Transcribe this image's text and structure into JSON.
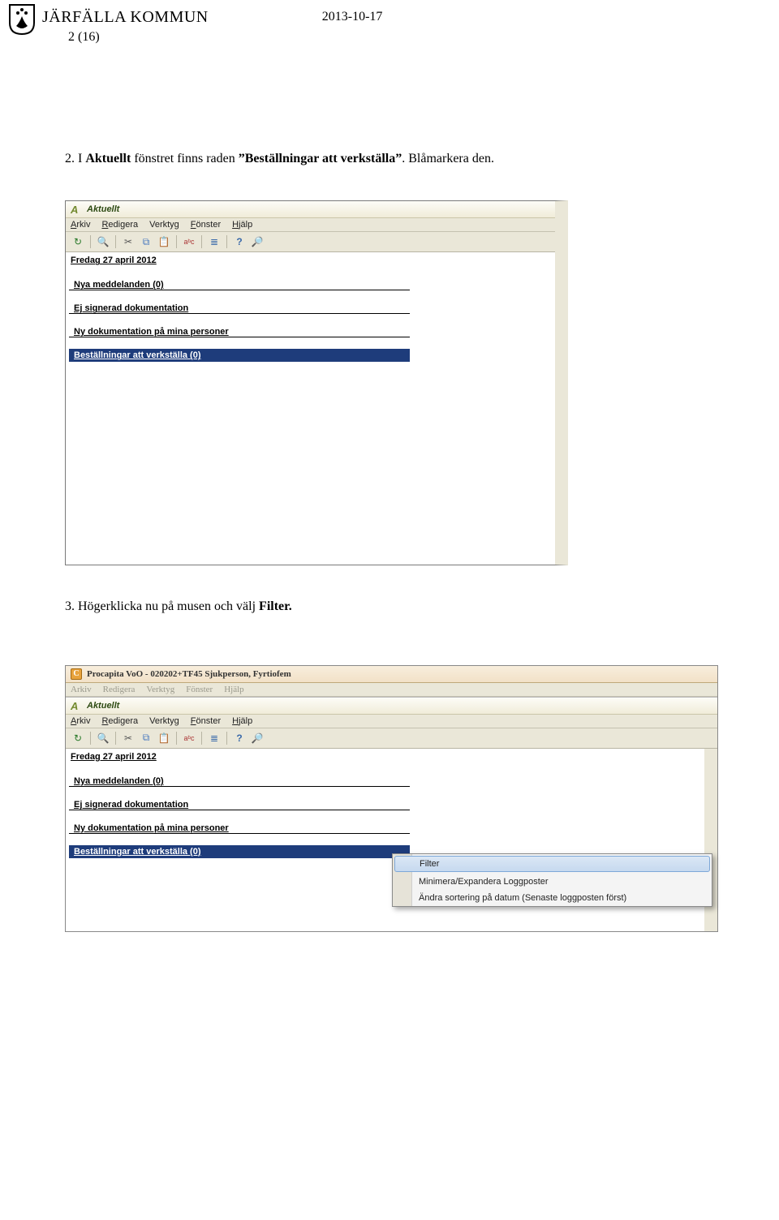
{
  "header": {
    "org": "JÄRFÄLLA KOMMUN",
    "date": "2013-10-17",
    "pagenum": "2 (16)"
  },
  "step2": {
    "prefix": "2. I ",
    "bold1": "Aktuellt",
    "mid": " fönstret finns raden ",
    "bold2": "”Beställningar att verkställa”",
    "suffix": ". Blåmarkera den."
  },
  "win1": {
    "title": "Aktuellt",
    "menus": [
      "Arkiv",
      "Redigera",
      "Verktyg",
      "Fönster",
      "Hjälp"
    ],
    "dateHeader": "Fredag 27 april 2012",
    "rows": [
      "Nya meddelanden    (0)",
      "Ej signerad dokumentation",
      "Ny dokumentation på mina personer"
    ],
    "selected": "Beställningar att verkställa    (0)"
  },
  "step3": {
    "prefix": "3. Högerklicka nu på musen och välj ",
    "bold1": "Filter."
  },
  "win2": {
    "outerTitle": "Procapita VoO - 020202+TF45 Sjukperson, Fyrtiofem",
    "outerMenus": [
      "Arkiv",
      "Redigera",
      "Verktyg",
      "Fönster",
      "Hjälp"
    ],
    "title": "Aktuellt",
    "menus": [
      "Arkiv",
      "Redigera",
      "Verktyg",
      "Fönster",
      "Hjälp"
    ],
    "dateHeader": "Fredag 27 april 2012",
    "rows": [
      "Nya meddelanden    (0)",
      "Ej signerad dokumentation",
      "Ny dokumentation på mina personer"
    ],
    "selected": "Beställningar att verkställa    (0)",
    "context": [
      {
        "label": "Filter",
        "sel": true
      },
      {
        "label": "Minimera/Expandera Loggposter",
        "sel": false
      },
      {
        "label": "Ändra sortering på datum (Senaste loggposten först)",
        "sel": false
      }
    ]
  },
  "icons": {
    "refresh": "↻",
    "binoc": "🔍",
    "cut": "✂",
    "copy": "⧉",
    "paste": "📋",
    "abc": "aᵇc",
    "sliders": "≣",
    "help": "?",
    "globe": "🔎"
  }
}
